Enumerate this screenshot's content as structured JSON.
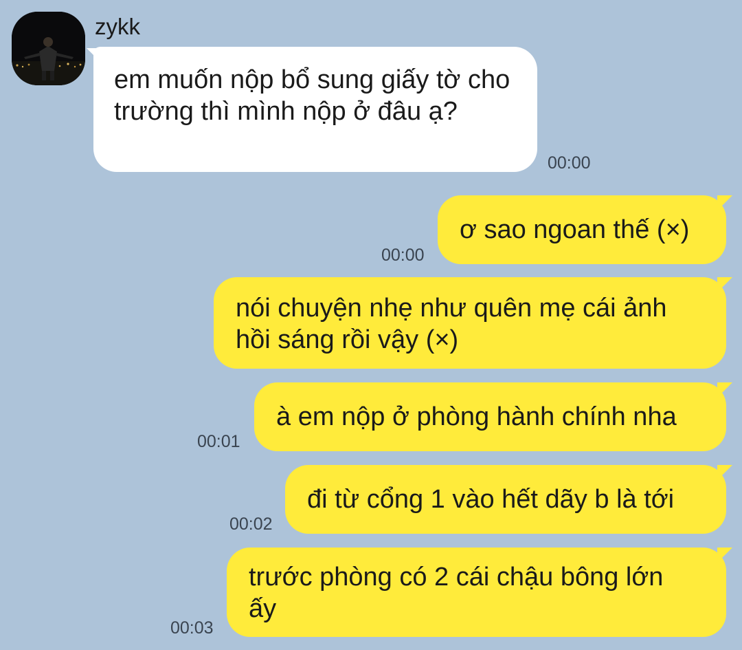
{
  "chat": {
    "contact_name": "zykk",
    "avatar_icon": "profile-photo-night-city",
    "colors": {
      "background": "#adc3d9",
      "incoming_bubble": "#ffffff",
      "outgoing_bubble": "#ffeb3b"
    },
    "messages": [
      {
        "side": "incoming",
        "text": "em muốn nộp bổ sung giấy tờ cho trường thì mình nộp ở đâu ạ?",
        "time": "00:00"
      },
      {
        "side": "outgoing",
        "text": "ơ sao ngoan thế (×)",
        "time": "00:00"
      },
      {
        "side": "outgoing",
        "line1": "nói chuyện nhẹ như quên mẹ cái ảnh",
        "line2": "hồi sáng rồi vậy (×)",
        "time": ""
      },
      {
        "side": "outgoing",
        "text": "à em nộp ở phòng hành chính nha",
        "time": "00:01"
      },
      {
        "side": "outgoing",
        "text": "đi từ cổng 1 vào hết dãy b là tới",
        "time": "00:02"
      },
      {
        "side": "outgoing",
        "line1": "trước phòng có 2 cái chậu bông lớn",
        "line2": "ấy",
        "time": "00:03"
      }
    ]
  }
}
